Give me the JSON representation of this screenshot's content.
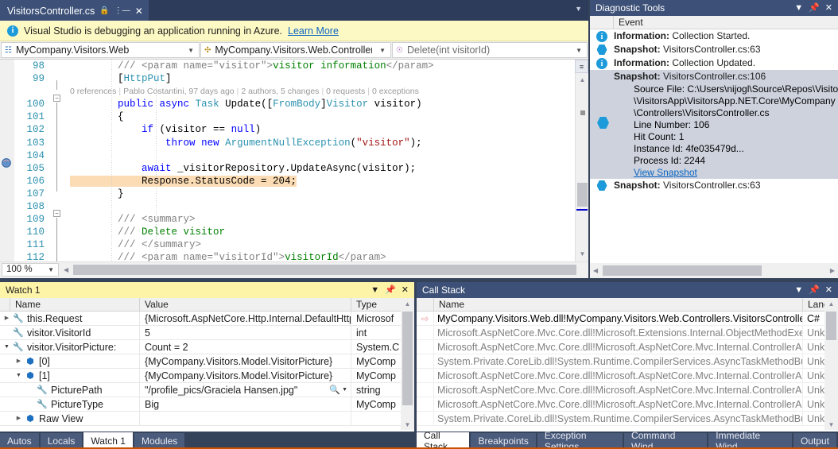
{
  "editor": {
    "tab": {
      "filename": "VisitorsController.cs",
      "pin_icon": "pin-icon",
      "close_icon": "close-icon",
      "lock_icon": "lock-icon"
    },
    "infobar": {
      "icon": "information-icon",
      "message": "Visual Studio is debugging an application running in Azure.",
      "link": "Learn More"
    },
    "navbar": {
      "project": "MyCompany.Visitors.Web",
      "type": "MyCompany.Visitors.Web.Controllers.\\",
      "member": "Delete(int visitorId)"
    },
    "codelens": {
      "references": "0 references",
      "author": "Pablo Costantini, 97 days ago",
      "changes": "2 authors, 5 changes",
      "requests": "0 requests",
      "exceptions": "0 exceptions"
    },
    "lines": [
      {
        "n": "98",
        "segs": [
          {
            "t": "        /// ",
            "c": "k-gray"
          },
          {
            "t": "<param name=",
            "c": "k-gray"
          },
          {
            "t": "\"visitor\"",
            "c": "k-gray"
          },
          {
            "t": ">",
            "c": "k-gray"
          },
          {
            "t": "visitor information",
            "c": "k-green"
          },
          {
            "t": "</param>",
            "c": "k-gray"
          }
        ]
      },
      {
        "n": "99",
        "segs": [
          {
            "t": "        [",
            "c": "k-black"
          },
          {
            "t": "HttpPut",
            "c": "k-teal"
          },
          {
            "t": "]",
            "c": "k-black"
          }
        ]
      },
      {
        "n": "100",
        "segs": [
          {
            "t": "        ",
            "c": "k-black"
          },
          {
            "t": "public",
            "c": "k-blue"
          },
          {
            "t": " ",
            "c": "k-black"
          },
          {
            "t": "async",
            "c": "k-blue"
          },
          {
            "t": " ",
            "c": "k-black"
          },
          {
            "t": "Task",
            "c": "k-teal"
          },
          {
            "t": " Update([",
            "c": "k-black"
          },
          {
            "t": "FromBody",
            "c": "k-teal"
          },
          {
            "t": "]",
            "c": "k-black"
          },
          {
            "t": "Visitor",
            "c": "k-teal"
          },
          {
            "t": " visitor)",
            "c": "k-black"
          }
        ]
      },
      {
        "n": "101",
        "segs": [
          {
            "t": "        {",
            "c": "k-black"
          }
        ]
      },
      {
        "n": "102",
        "segs": [
          {
            "t": "            ",
            "c": "k-black"
          },
          {
            "t": "if",
            "c": "k-blue"
          },
          {
            "t": " (visitor == ",
            "c": "k-black"
          },
          {
            "t": "null",
            "c": "k-blue"
          },
          {
            "t": ")",
            "c": "k-black"
          }
        ]
      },
      {
        "n": "103",
        "segs": [
          {
            "t": "                ",
            "c": "k-black"
          },
          {
            "t": "throw",
            "c": "k-blue"
          },
          {
            "t": " ",
            "c": "k-black"
          },
          {
            "t": "new",
            "c": "k-blue"
          },
          {
            "t": " ",
            "c": "k-black"
          },
          {
            "t": "ArgumentNullException",
            "c": "k-teal"
          },
          {
            "t": "(",
            "c": "k-black"
          },
          {
            "t": "\"visitor\"",
            "c": "k-red"
          },
          {
            "t": ");",
            "c": "k-black"
          }
        ]
      },
      {
        "n": "104",
        "segs": [
          {
            "t": "",
            "c": "k-black"
          }
        ]
      },
      {
        "n": "105",
        "segs": [
          {
            "t": "            ",
            "c": "k-black"
          },
          {
            "t": "await",
            "c": "k-blue"
          },
          {
            "t": " _visitorRepository.UpdateAsync(visitor);",
            "c": "k-black"
          }
        ]
      },
      {
        "n": "106",
        "segs": [
          {
            "t": "            ",
            "c": "k-black"
          },
          {
            "t": "Response.StatusCode = 204;",
            "c": "k-black"
          }
        ],
        "highlight": true
      },
      {
        "n": "107",
        "segs": [
          {
            "t": "        }",
            "c": "k-black"
          }
        ]
      },
      {
        "n": "108",
        "segs": [
          {
            "t": "",
            "c": "k-black"
          }
        ]
      },
      {
        "n": "109",
        "segs": [
          {
            "t": "        /// ",
            "c": "k-gray"
          },
          {
            "t": "<summary>",
            "c": "k-gray"
          }
        ]
      },
      {
        "n": "110",
        "segs": [
          {
            "t": "        /// ",
            "c": "k-gray"
          },
          {
            "t": "Delete visitor",
            "c": "k-green"
          }
        ]
      },
      {
        "n": "111",
        "segs": [
          {
            "t": "        /// ",
            "c": "k-gray"
          },
          {
            "t": "</summary>",
            "c": "k-gray"
          }
        ]
      },
      {
        "n": "112",
        "segs": [
          {
            "t": "        /// ",
            "c": "k-gray"
          },
          {
            "t": "<param name=",
            "c": "k-gray"
          },
          {
            "t": "\"visitorId\"",
            "c": "k-gray"
          },
          {
            "t": ">",
            "c": "k-gray"
          },
          {
            "t": "visitorId",
            "c": "k-green"
          },
          {
            "t": "</param>",
            "c": "k-gray"
          }
        ]
      }
    ],
    "zoom_level": "100 %"
  },
  "diagnostics": {
    "title": "Diagnostic Tools",
    "column_header": "Event",
    "events": [
      {
        "icon": "information-icon",
        "label": "Information:",
        "text": "Collection Started."
      },
      {
        "icon": "snapshot-icon",
        "label": "Snapshot:",
        "text": "VisitorsController.cs:63"
      },
      {
        "icon": "information-icon",
        "label": "Information:",
        "text": "Collection Updated."
      }
    ],
    "selected": {
      "icon": "snapshot-icon",
      "label": "Snapshot:",
      "text": "VisitorsController.cs:106",
      "details": [
        "Source File: C:\\Users\\nijogl\\Source\\Repos\\Visito",
        "\\VisitorsApp\\VisitorsApp.NET.Core\\MyCompany",
        "\\Controllers\\VisitorsController.cs",
        "Line Number: 106",
        "Hit Count: 1",
        "Instance Id: 4fe035479d...",
        "Process Id: 2244"
      ],
      "link": "View Snapshot"
    },
    "last_event": {
      "icon": "snapshot-icon",
      "label": "Snapshot:",
      "text": "VisitorsController.cs:63"
    }
  },
  "watch": {
    "title": "Watch 1",
    "columns": [
      "Name",
      "Value",
      "Type"
    ],
    "rows": [
      {
        "indent": 0,
        "expander": "collapsed",
        "icon": "wrench-icon",
        "name": "this.Request",
        "value": "{Microsoft.AspNetCore.Http.Internal.DefaultHttpReque",
        "type": "Microsof"
      },
      {
        "indent": 0,
        "expander": "none",
        "icon": "wrench-icon",
        "name": "visitor.VisitorId",
        "value": "5",
        "type": "int"
      },
      {
        "indent": 0,
        "expander": "expanded",
        "icon": "wrench-icon",
        "name": "visitor.VisitorPicture:",
        "value": "Count = 2",
        "type": "System.C"
      },
      {
        "indent": 1,
        "expander": "collapsed",
        "icon": "object-icon",
        "name": "[0]",
        "value": "{MyCompany.Visitors.Model.VisitorPicture}",
        "type": "MyComp"
      },
      {
        "indent": 1,
        "expander": "expanded",
        "icon": "object-icon",
        "name": "[1]",
        "value": "{MyCompany.Visitors.Model.VisitorPicture}",
        "type": "MyComp"
      },
      {
        "indent": 2,
        "expander": "none",
        "icon": "wrench-icon",
        "name": "PicturePath",
        "value": "\"/profile_pics/Graciela Hansen.jpg\"",
        "type": "string",
        "magnifier": true
      },
      {
        "indent": 2,
        "expander": "none",
        "icon": "wrench-icon",
        "name": "PictureType",
        "value": "Big",
        "type": "MyComp"
      },
      {
        "indent": 1,
        "expander": "collapsed",
        "icon": "object-icon",
        "name": "Raw View",
        "value": "",
        "type": ""
      }
    ],
    "tabs": [
      {
        "label": "Autos",
        "selected": false
      },
      {
        "label": "Locals",
        "selected": false
      },
      {
        "label": "Watch 1",
        "selected": true
      },
      {
        "label": "Modules",
        "selected": false
      }
    ]
  },
  "callstack": {
    "title": "Call Stack",
    "columns": [
      "Name",
      "Lang"
    ],
    "rows": [
      {
        "current": true,
        "name": "MyCompany.Visitors.Web.dll!MyCompany.Visitors.Web.Controllers.VisitorsController.",
        "lang": "C#"
      },
      {
        "current": false,
        "name": "Microsoft.AspNetCore.Mvc.Core.dll!Microsoft.Extensions.Internal.ObjectMethodExecu",
        "lang": "Unkn"
      },
      {
        "current": false,
        "name": "Microsoft.AspNetCore.Mvc.Core.dll!Microsoft.AspNetCore.Mvc.Internal.ControllerAct",
        "lang": "Unkn"
      },
      {
        "current": false,
        "name": "System.Private.CoreLib.dll!System.Runtime.CompilerServices.AsyncTaskMethodBuilde",
        "lang": "Unkn"
      },
      {
        "current": false,
        "name": "Microsoft.AspNetCore.Mvc.Core.dll!Microsoft.AspNetCore.Mvc.Internal.ControllerAct",
        "lang": "Unkn"
      },
      {
        "current": false,
        "name": "Microsoft.AspNetCore.Mvc.Core.dll!Microsoft.AspNetCore.Mvc.Internal.ControllerAct",
        "lang": "Unkn"
      },
      {
        "current": false,
        "name": "Microsoft.AspNetCore.Mvc.Core.dll!Microsoft.AspNetCore.Mvc.Internal.ControllerAct",
        "lang": "Unkn"
      },
      {
        "current": false,
        "name": "System.Private.CoreLib.dll!System.Runtime.CompilerServices.AsyncTaskMethodBuilde",
        "lang": "Unkn"
      }
    ],
    "tabs": [
      {
        "label": "Call Stack",
        "selected": true
      },
      {
        "label": "Breakpoints",
        "selected": false
      },
      {
        "label": "Exception Settings",
        "selected": false
      },
      {
        "label": "Command Wind...",
        "selected": false
      },
      {
        "label": "Immediate Wind...",
        "selected": false
      },
      {
        "label": "Output",
        "selected": false
      }
    ]
  },
  "colors": {
    "chrome": "#3d5178",
    "accent_yellow": "#fdf9c4",
    "link": "#0a65c1",
    "status_orange": "#ca5100",
    "snapshot_blue": "#1d9ada",
    "highlight_statement": "#fcdcb4"
  }
}
